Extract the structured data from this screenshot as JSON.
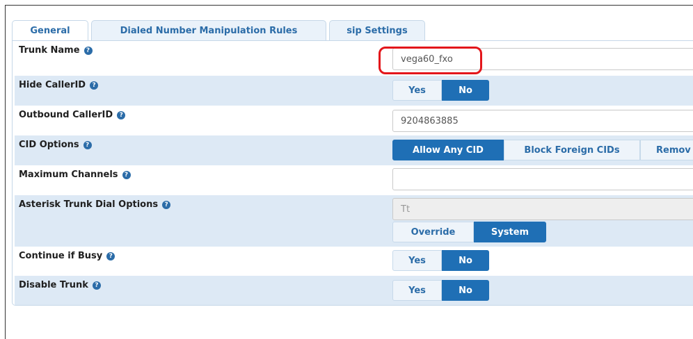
{
  "tabs": [
    {
      "label": "General",
      "active": true
    },
    {
      "label": "Dialed Number Manipulation Rules",
      "active": false
    },
    {
      "label": "sip Settings",
      "active": false
    }
  ],
  "help_glyph": "?",
  "fields": {
    "trunk_name": {
      "label": "Trunk Name",
      "value": "vega60_fxo"
    },
    "hide_callerid": {
      "label": "Hide CallerID",
      "options": [
        "Yes",
        "No"
      ],
      "selected": "No"
    },
    "outbound_callerid": {
      "label": "Outbound CallerID",
      "value": "9204863885"
    },
    "cid_options": {
      "label": "CID Options",
      "options": [
        "Allow Any CID",
        "Block Foreign CIDs",
        "Remov"
      ],
      "selected": "Allow Any CID"
    },
    "maximum_channels": {
      "label": "Maximum Channels",
      "value": ""
    },
    "asterisk_trunk_dial_options": {
      "label": "Asterisk Trunk Dial Options",
      "value": "Tt",
      "options": [
        "Override",
        "System"
      ],
      "selected": "System"
    },
    "continue_if_busy": {
      "label": "Continue if Busy",
      "options": [
        "Yes",
        "No"
      ],
      "selected": "No"
    },
    "disable_trunk": {
      "label": "Disable Trunk",
      "options": [
        "Yes",
        "No"
      ],
      "selected": "No"
    }
  },
  "colors": {
    "accent": "#1f6fb5",
    "row_shade": "#dde9f5",
    "highlight": "#e3161b"
  }
}
